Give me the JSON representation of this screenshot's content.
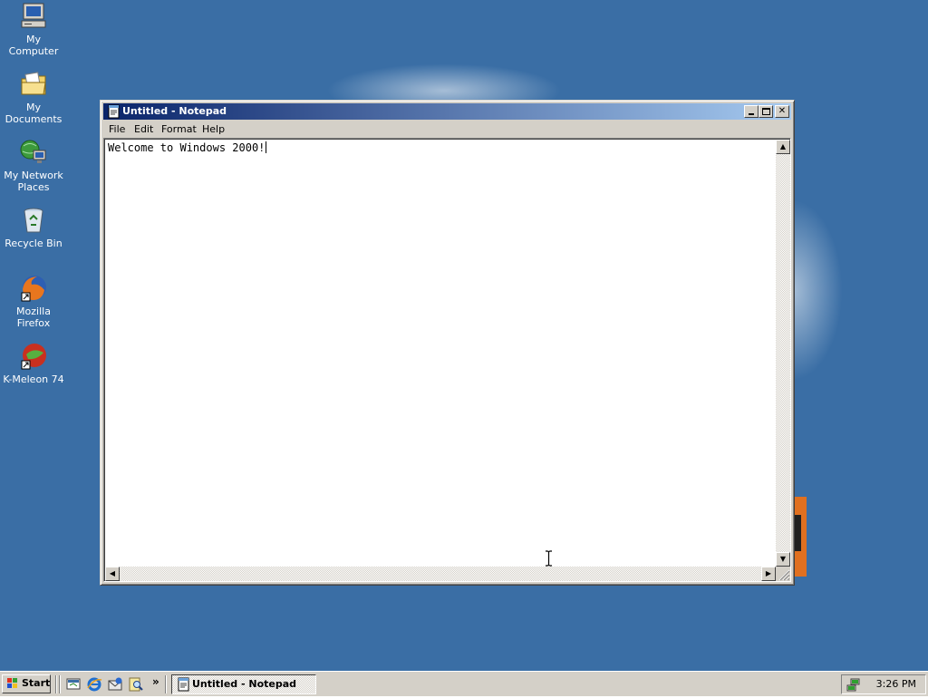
{
  "desktop": {
    "background_color": "#3a6ea5",
    "icons": [
      {
        "label": "My Computer",
        "icon": "computer-icon"
      },
      {
        "label": "My Documents",
        "icon": "folder-documents-icon"
      },
      {
        "label_line1": "My Network",
        "label_line2": "Places",
        "icon": "network-places-icon"
      },
      {
        "label": "Recycle Bin",
        "icon": "recycle-bin-icon"
      },
      {
        "label": "Mozilla Firefox",
        "icon": "firefox-icon"
      },
      {
        "label": "K-Meleon 74",
        "icon": "kmeleon-icon"
      }
    ]
  },
  "notepad": {
    "title": "Untitled - Notepad",
    "title_bar_color": "#0a246a",
    "menu": [
      "File",
      "Edit",
      "Format",
      "Help"
    ],
    "content": "Welcome to Windows 2000!",
    "buttons": {
      "minimize": "minimize-icon",
      "maximize": "maximize-icon",
      "close": "close-icon"
    }
  },
  "taskbar": {
    "start_label": "Start",
    "quick_launch": [
      "show-desktop-icon",
      "internet-explorer-icon",
      "outlook-express-icon",
      "search-icon"
    ],
    "more_label": "»",
    "tasks": [
      {
        "label": "Untitled - Notepad",
        "active": true
      }
    ],
    "clock": "3:26 PM"
  }
}
